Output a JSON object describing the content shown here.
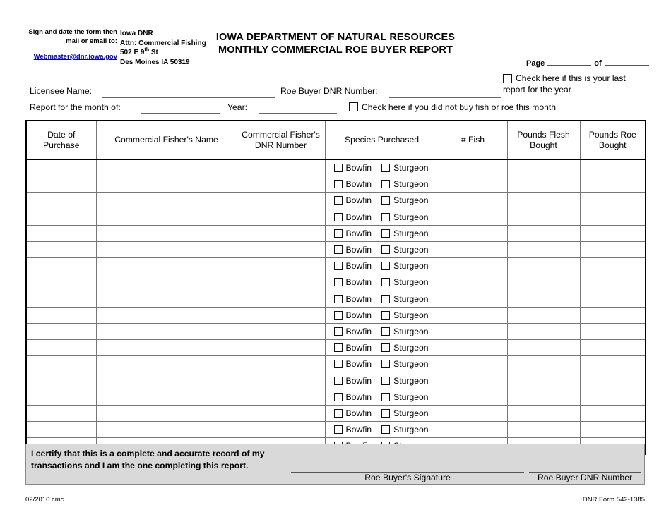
{
  "mailing": {
    "instruction_line1": "Sign and date the form then",
    "instruction_line2": "mail or email to:",
    "email": "Webmaster@dnr.iowa.gov",
    "link_color": "#0000CC",
    "address": {
      "org": "Iowa DNR",
      "attn": "Attn: Commercial Fishing",
      "street_main": "502 E 9",
      "street_sup": "th",
      "street_suffix": " St",
      "city_state_zip": "Des Moines IA 50319"
    }
  },
  "header": {
    "title_line1": "IOWA DEPARTMENT OF NATURAL RESOURCES",
    "title_line2_underlined": "MONTHLY",
    "title_line2_rest": " COMMERCIAL ROE BUYER REPORT",
    "page_label": "Page",
    "of_label": "of",
    "last_report_checkbox_label": "Check here if this is your last report for the year"
  },
  "fields": {
    "licensee_name_label": "Licensee Name:",
    "licensee_name_value": "",
    "roe_buyer_dnr_label": "Roe Buyer DNR Number:",
    "roe_buyer_dnr_value": "",
    "month_label": "Report for the month of:",
    "month_value": "",
    "year_label": "Year:",
    "year_value": "",
    "no_purchase_checkbox_label": "Check here if you did not buy fish or roe this month"
  },
  "table": {
    "columns": [
      "Date of Purchase",
      "Commercial Fisher's Name",
      "Commercial Fisher's DNR Number",
      "Species Purchased",
      "# Fish",
      "Pounds Flesh Bought",
      "Pounds Roe Bought"
    ],
    "species_options": [
      "Bowfin",
      "Sturgeon"
    ],
    "row_count": 18,
    "rows": [
      {
        "date": "",
        "fisher_name": "",
        "fisher_dnr": "",
        "bowfin": false,
        "sturgeon": false,
        "num_fish": "",
        "pounds_flesh": "",
        "pounds_roe": ""
      },
      {
        "date": "",
        "fisher_name": "",
        "fisher_dnr": "",
        "bowfin": false,
        "sturgeon": false,
        "num_fish": "",
        "pounds_flesh": "",
        "pounds_roe": ""
      },
      {
        "date": "",
        "fisher_name": "",
        "fisher_dnr": "",
        "bowfin": false,
        "sturgeon": false,
        "num_fish": "",
        "pounds_flesh": "",
        "pounds_roe": ""
      },
      {
        "date": "",
        "fisher_name": "",
        "fisher_dnr": "",
        "bowfin": false,
        "sturgeon": false,
        "num_fish": "",
        "pounds_flesh": "",
        "pounds_roe": ""
      },
      {
        "date": "",
        "fisher_name": "",
        "fisher_dnr": "",
        "bowfin": false,
        "sturgeon": false,
        "num_fish": "",
        "pounds_flesh": "",
        "pounds_roe": ""
      },
      {
        "date": "",
        "fisher_name": "",
        "fisher_dnr": "",
        "bowfin": false,
        "sturgeon": false,
        "num_fish": "",
        "pounds_flesh": "",
        "pounds_roe": ""
      },
      {
        "date": "",
        "fisher_name": "",
        "fisher_dnr": "",
        "bowfin": false,
        "sturgeon": false,
        "num_fish": "",
        "pounds_flesh": "",
        "pounds_roe": ""
      },
      {
        "date": "",
        "fisher_name": "",
        "fisher_dnr": "",
        "bowfin": false,
        "sturgeon": false,
        "num_fish": "",
        "pounds_flesh": "",
        "pounds_roe": ""
      },
      {
        "date": "",
        "fisher_name": "",
        "fisher_dnr": "",
        "bowfin": false,
        "sturgeon": false,
        "num_fish": "",
        "pounds_flesh": "",
        "pounds_roe": ""
      },
      {
        "date": "",
        "fisher_name": "",
        "fisher_dnr": "",
        "bowfin": false,
        "sturgeon": false,
        "num_fish": "",
        "pounds_flesh": "",
        "pounds_roe": ""
      },
      {
        "date": "",
        "fisher_name": "",
        "fisher_dnr": "",
        "bowfin": false,
        "sturgeon": false,
        "num_fish": "",
        "pounds_flesh": "",
        "pounds_roe": ""
      },
      {
        "date": "",
        "fisher_name": "",
        "fisher_dnr": "",
        "bowfin": false,
        "sturgeon": false,
        "num_fish": "",
        "pounds_flesh": "",
        "pounds_roe": ""
      },
      {
        "date": "",
        "fisher_name": "",
        "fisher_dnr": "",
        "bowfin": false,
        "sturgeon": false,
        "num_fish": "",
        "pounds_flesh": "",
        "pounds_roe": ""
      },
      {
        "date": "",
        "fisher_name": "",
        "fisher_dnr": "",
        "bowfin": false,
        "sturgeon": false,
        "num_fish": "",
        "pounds_flesh": "",
        "pounds_roe": ""
      },
      {
        "date": "",
        "fisher_name": "",
        "fisher_dnr": "",
        "bowfin": false,
        "sturgeon": false,
        "num_fish": "",
        "pounds_flesh": "",
        "pounds_roe": ""
      },
      {
        "date": "",
        "fisher_name": "",
        "fisher_dnr": "",
        "bowfin": false,
        "sturgeon": false,
        "num_fish": "",
        "pounds_flesh": "",
        "pounds_roe": ""
      },
      {
        "date": "",
        "fisher_name": "",
        "fisher_dnr": "",
        "bowfin": false,
        "sturgeon": false,
        "num_fish": "",
        "pounds_flesh": "",
        "pounds_roe": ""
      },
      {
        "date": "",
        "fisher_name": "",
        "fisher_dnr": "",
        "bowfin": false,
        "sturgeon": false,
        "num_fish": "",
        "pounds_flesh": "",
        "pounds_roe": ""
      }
    ]
  },
  "certification": {
    "text_line1": "I certify that this is a complete and accurate record of my",
    "text_line2": "transactions and I am the one completing this report.",
    "signature_label": "Roe Buyer's Signature",
    "dnr_number_label": "Roe Buyer DNR Number",
    "signature_value": "",
    "dnr_number_value": "",
    "background_color": "#D9D9D9"
  },
  "footer": {
    "revision": "02/2016 cmc",
    "form_number": "DNR Form 542-1385"
  }
}
